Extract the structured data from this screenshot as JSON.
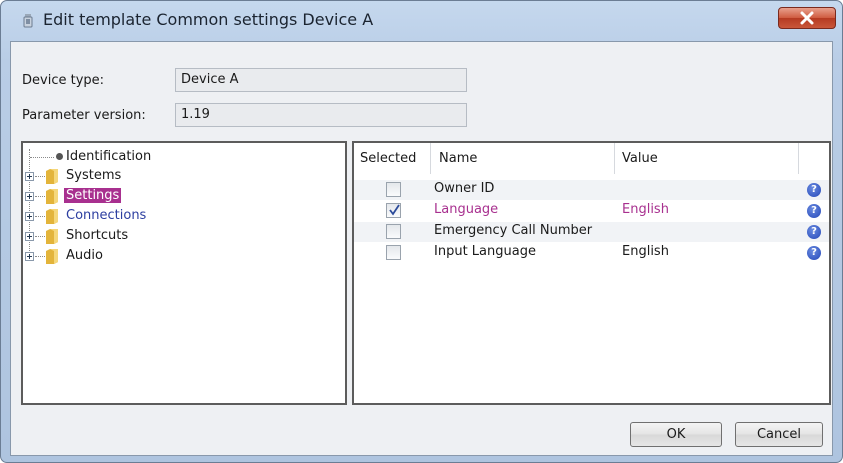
{
  "window": {
    "title": "Edit template Common settings Device A"
  },
  "fields": {
    "device_type_label": "Device type:",
    "device_type_value": "Device A",
    "parameter_version_label": "Parameter version:",
    "parameter_version_value": "1.19"
  },
  "tree": {
    "items": [
      {
        "label": "Identification"
      },
      {
        "label": "Systems"
      },
      {
        "label": "Settings"
      },
      {
        "label": "Connections"
      },
      {
        "label": "Shortcuts"
      },
      {
        "label": "Audio"
      }
    ],
    "selected": "Settings"
  },
  "table": {
    "headers": {
      "selected": "Selected",
      "name": "Name",
      "value": "Value"
    },
    "rows": [
      {
        "selected": false,
        "name": "Owner ID",
        "value": ""
      },
      {
        "selected": true,
        "name": "Language",
        "value": "English"
      },
      {
        "selected": false,
        "name": "Emergency Call Number",
        "value": ""
      },
      {
        "selected": false,
        "name": "Input Language",
        "value": "English"
      }
    ],
    "help_glyph": "?"
  },
  "buttons": {
    "ok": "OK",
    "cancel": "Cancel"
  },
  "colors": {
    "selection": "#a8308f",
    "link": "#2c3ea0",
    "close_button": "#c9573a"
  },
  "icons": [
    "app-icon",
    "close-icon",
    "folder-icon",
    "leaf-node-icon",
    "expand-icon",
    "checkmark-icon",
    "help-icon"
  ]
}
